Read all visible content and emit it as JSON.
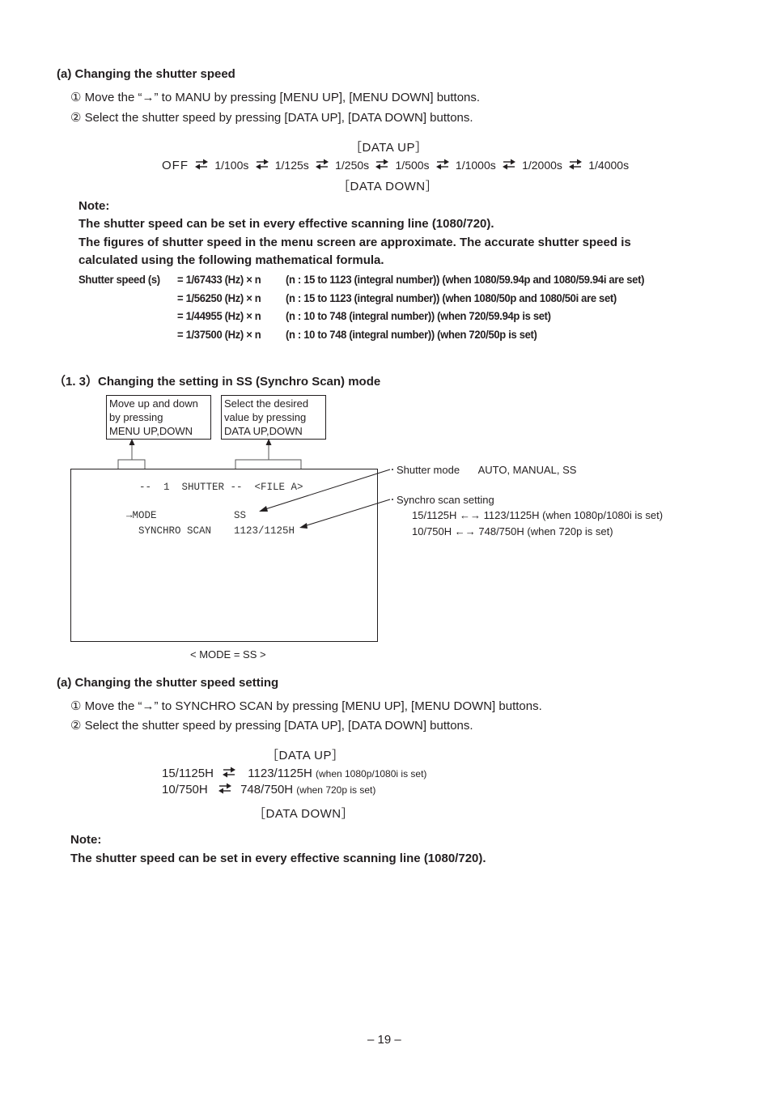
{
  "section_a1": {
    "heading": "(a) Changing the shutter speed",
    "steps": [
      {
        "num": "①",
        "text": "Move the “→” to MANU by pressing [MENU UP], [MENU DOWN] buttons."
      },
      {
        "num": "②",
        "text": "Select the shutter speed by pressing [DATA UP], [DATA DOWN] buttons."
      }
    ],
    "data_up": "［DATA UP］",
    "data_down": "［DATA DOWN］",
    "sequence": [
      "OFF",
      "1/100s",
      "1/125s",
      "1/250s",
      "1/500s",
      "1/1000s",
      "1/2000s",
      "1/4000s"
    ],
    "swap_icon": "two-way-arrow-icon"
  },
  "note1": {
    "label": "Note:",
    "lines": [
      "The shutter speed can be set in every effective scanning line (1080/720).",
      "The figures of shutter speed in the menu screen are approximate. The accurate shutter speed is",
      "calculated using the following mathematical formula."
    ],
    "formula_prefix": "Shutter speed (s)",
    "formulas": [
      {
        "expr": "= 1/67433 (Hz) × n",
        "cond": "(n : 15 to 1123 (integral number)) (when 1080/59.94p and 1080/59.94i are set)"
      },
      {
        "expr": "= 1/56250 (Hz) × n",
        "cond": "(n : 15 to 1123 (integral number)) (when 1080/50p and 1080/50i are set)"
      },
      {
        "expr": "= 1/44955 (Hz) × n",
        "cond": "(n : 10 to 748 (integral number)) (when 720/59.94p is set)"
      },
      {
        "expr": "= 1/37500 (Hz) × n",
        "cond": "(n : 10 to 748 (integral number)) (when 720/50p is set)"
      }
    ]
  },
  "section_13": {
    "heading": "（1. 3）Changing the setting in SS (Synchro Scan) mode",
    "callout_menu": [
      "Move up and down",
      "by pressing",
      "MENU UP,DOWN"
    ],
    "callout_data": [
      "Select the desired",
      "value by pressing",
      "DATA UP,DOWN"
    ],
    "screen": {
      "title": "--  1  SHUTTER --  <FILE A>",
      "rows": [
        {
          "cursor": "→",
          "label": "MODE",
          "value": "SS"
        },
        {
          "cursor": "",
          "label": "SYNCHRO SCAN",
          "value": "1123/1125H"
        }
      ],
      "caption": "< MODE = SS >"
    },
    "annotations": {
      "shutter_mode_label": "Shutter mode",
      "shutter_mode_values": "AUTO, MANUAL, SS",
      "synchro_label": "Synchro scan setting",
      "synchro_lines": [
        "15/1125H ←→ 1123/1125H (when 1080p/1080i is set)",
        "10/750H ←→ 748/750H (when 720p is set)"
      ]
    }
  },
  "section_a2": {
    "heading": "(a) Changing the shutter speed setting",
    "steps": [
      {
        "num": "①",
        "text": "Move the “→” to SYNCHRO SCAN by pressing [MENU UP], [MENU DOWN] buttons."
      },
      {
        "num": "②",
        "text": "Select the shutter speed by pressing [DATA UP], [DATA DOWN] buttons."
      }
    ],
    "data_up": "［DATA UP］",
    "data_down": "［DATA DOWN］",
    "ranges": [
      {
        "from": "15/1125H",
        "to": "1123/1125H",
        "cond": "(when 1080p/1080i is set)"
      },
      {
        "from": "10/750H",
        "to": "748/750H",
        "cond": "(when 720p is set)"
      }
    ]
  },
  "note2": {
    "label": "Note:",
    "line": "The shutter speed can be set in every effective scanning line (1080/720)."
  },
  "page_number": "– 19 –"
}
